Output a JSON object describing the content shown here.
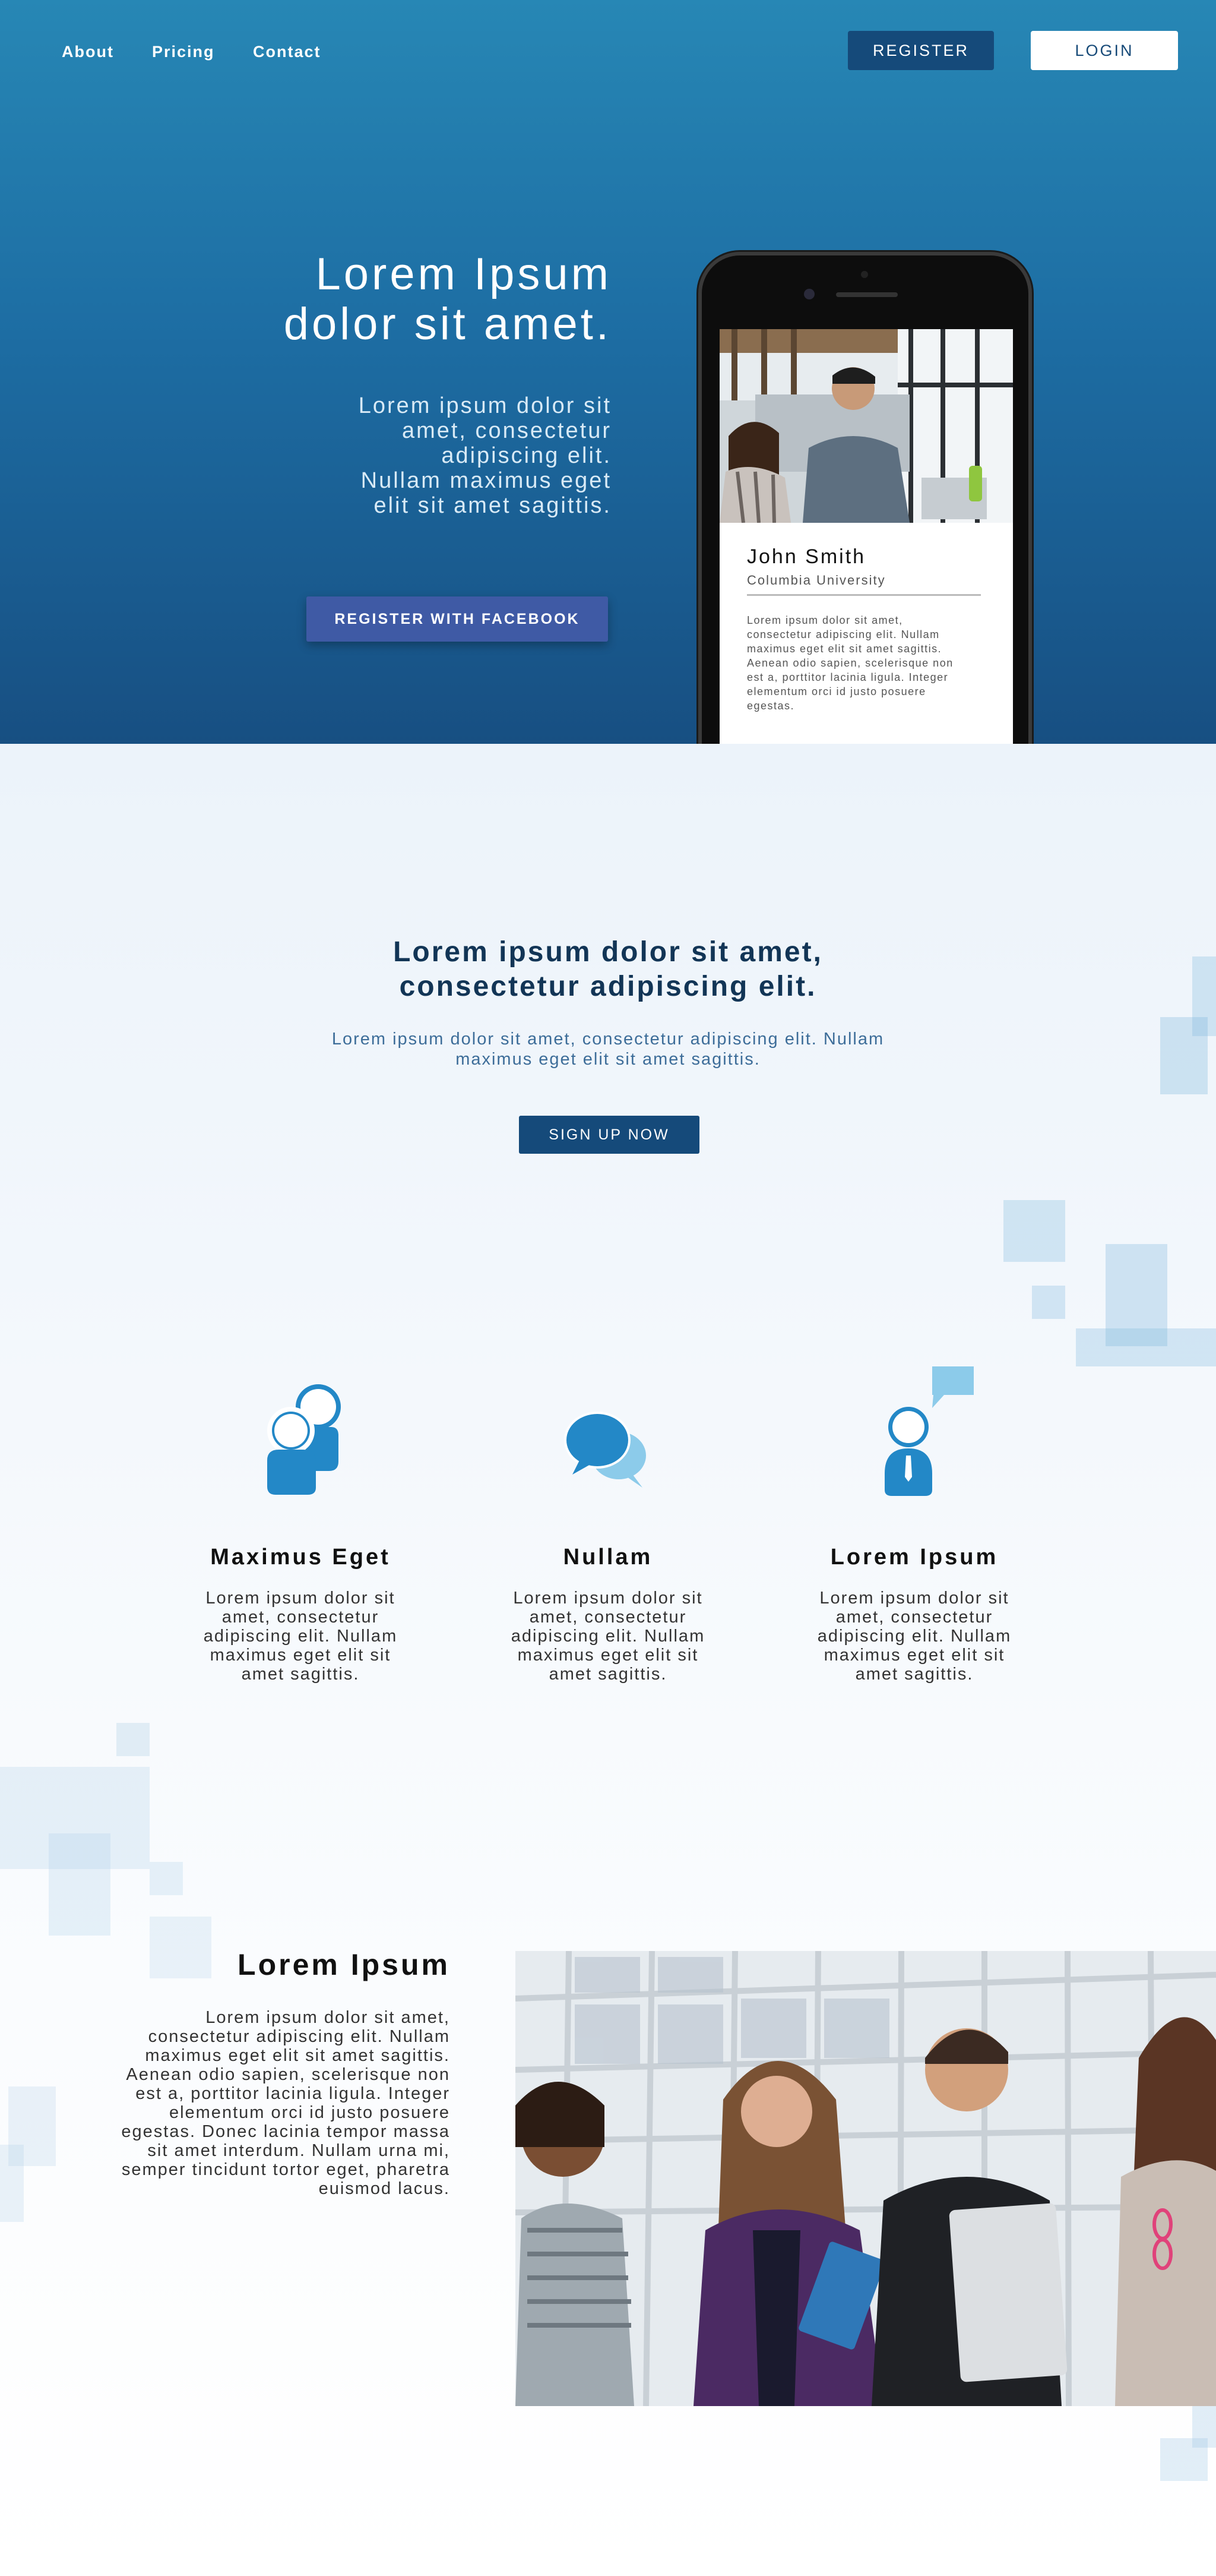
{
  "nav": {
    "links": [
      "About",
      "Pricing",
      "Contact"
    ],
    "register_label": "REGISTER",
    "login_label": "LOGIN"
  },
  "hero": {
    "title_line1": "Lorem Ipsum",
    "title_line2": "dolor sit amet.",
    "subtitle_lines": [
      "Lorem ipsum dolor sit",
      "amet, consectetur",
      "adipiscing elit.",
      "Nullam maximus eget",
      "elit sit amet sagittis."
    ],
    "facebook_label": "REGISTER WITH FACEBOOK"
  },
  "phone_profile": {
    "name": "John Smith",
    "school": "Columbia University",
    "bio_lines": [
      "Lorem ipsum dolor sit amet,",
      "consectetur adipiscing elit. Nullam",
      "maximus eget elit sit amet sagittis.",
      "Aenean odio sapien, scelerisque non",
      "est a, porttitor lacinia ligula. Integer",
      "elementum orci id justo posuere",
      "egestas."
    ]
  },
  "section2": {
    "title_line1": "Lorem ipsum dolor sit amet,",
    "title_line2": "consectetur adipiscing elit.",
    "sub_line1": "Lorem ipsum dolor sit amet, consectetur adipiscing elit. Nullam",
    "sub_line2": "maximus eget elit sit amet sagittis.",
    "signup_label": "SIGN UP NOW"
  },
  "features": [
    {
      "icon": "users-icon",
      "title": "Maximus Eget",
      "lines": [
        "Lorem ipsum dolor sit",
        "amet, consectetur",
        "adipiscing elit. Nullam",
        "maximus eget elit sit",
        "amet sagittis."
      ]
    },
    {
      "icon": "chat-bubbles-icon",
      "title": "Nullam",
      "lines": [
        "Lorem ipsum dolor sit",
        "amet, consectetur",
        "adipiscing elit. Nullam",
        "maximus eget elit sit",
        "amet sagittis."
      ]
    },
    {
      "icon": "user-message-icon",
      "title": "Lorem Ipsum",
      "lines": [
        "Lorem ipsum dolor sit",
        "amet, consectetur",
        "adipiscing elit. Nullam",
        "maximus eget elit sit",
        "amet sagittis."
      ]
    }
  ],
  "section4": {
    "title": "Lorem Ipsum",
    "lines": [
      "Lorem ipsum dolor sit amet,",
      "consectetur adipiscing elit. Nullam",
      "maximus eget elit sit amet sagittis.",
      "Aenean odio sapien, scelerisque non",
      "est a, porttitor lacinia ligula. Integer",
      "elementum orci id justo posuere",
      "egestas. Donec lacinia tempor massa",
      "sit amet interdum. Nullam urna mi,",
      "semper tincidunt tortor eget, pharetra",
      "euismod lacus."
    ]
  },
  "colors": {
    "hero_top": "#2787b5",
    "hero_bottom": "#174f82",
    "navy_button": "#154a7a",
    "facebook_button": "#3f5aa5",
    "icon_blue": "#2388c7",
    "icon_light": "#8ccbea"
  }
}
